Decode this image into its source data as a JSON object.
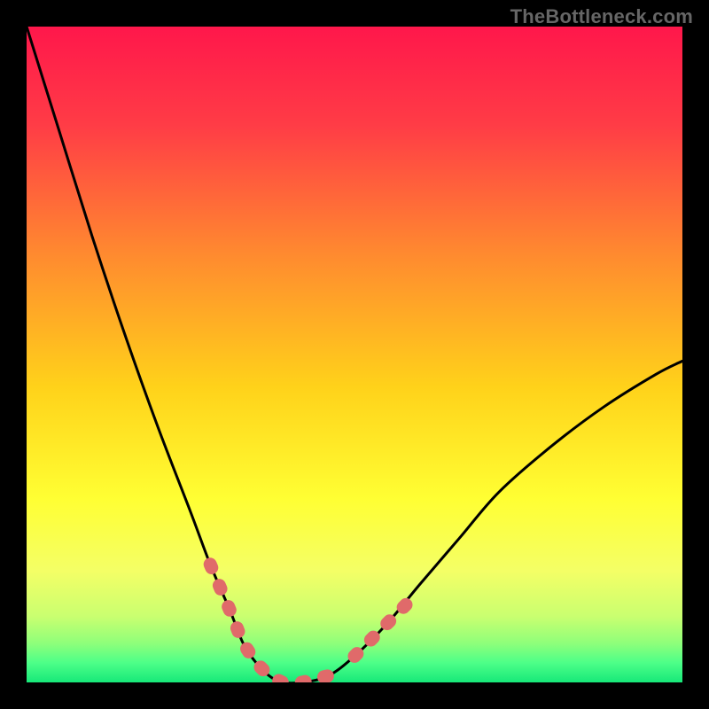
{
  "watermark": "TheBottleneck.com",
  "chart_data": {
    "type": "line",
    "title": "",
    "xlabel": "",
    "ylabel": "",
    "xlim": [
      0,
      100
    ],
    "ylim": [
      0,
      100
    ],
    "notes": "Abstract bottleneck curve on a vertical red→yellow→green gradient. No numeric axes or tick labels are visible; x/y values below are estimated relative coordinates (0–100) read from the curve shape.",
    "background_gradient": {
      "direction": "vertical",
      "stops": [
        {
          "offset": 0.0,
          "color": "#ff174b"
        },
        {
          "offset": 0.15,
          "color": "#ff3c46"
        },
        {
          "offset": 0.35,
          "color": "#ff8b2f"
        },
        {
          "offset": 0.55,
          "color": "#ffd21a"
        },
        {
          "offset": 0.72,
          "color": "#ffff33"
        },
        {
          "offset": 0.83,
          "color": "#f4ff66"
        },
        {
          "offset": 0.9,
          "color": "#c9ff70"
        },
        {
          "offset": 0.94,
          "color": "#8fff7a"
        },
        {
          "offset": 0.97,
          "color": "#4dff88"
        },
        {
          "offset": 1.0,
          "color": "#17e879"
        }
      ]
    },
    "series": [
      {
        "name": "bottleneck-curve",
        "color": "#000000",
        "x": [
          0,
          5,
          10,
          15,
          20,
          25,
          28,
          31,
          33,
          35,
          37,
          39,
          42,
          46,
          50,
          55,
          60,
          66,
          72,
          80,
          88,
          96,
          100
        ],
        "y": [
          100,
          84,
          68,
          53,
          39,
          26,
          18,
          11,
          6,
          3,
          1,
          0,
          0,
          1,
          4,
          9,
          15,
          22,
          29,
          36,
          42,
          47,
          49
        ]
      },
      {
        "name": "highlight-segments",
        "color": "#e06a6a",
        "segments": [
          {
            "x": [
              28,
              31,
              33,
              35,
              37,
              39,
              42,
              46
            ],
            "y": [
              18,
              11,
              6,
              3,
              1,
              0,
              0,
              1
            ]
          },
          {
            "x": [
              50,
              53,
              56,
              59
            ],
            "y": [
              4,
              7,
              10,
              13
            ]
          }
        ]
      }
    ]
  }
}
